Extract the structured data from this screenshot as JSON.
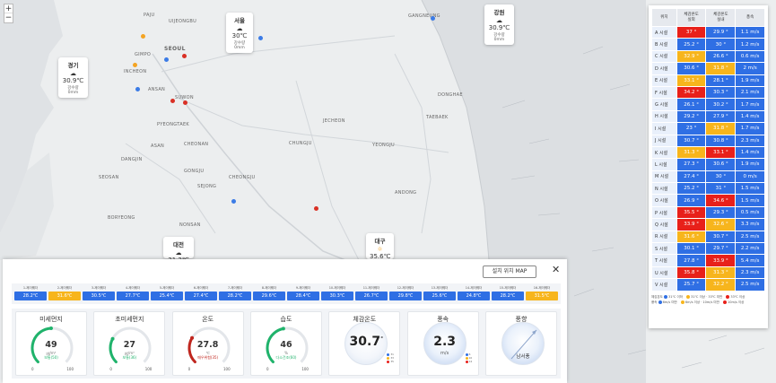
{
  "map": {
    "zoom_in": "+",
    "zoom_out": "−",
    "labels": [
      "PAJU",
      "UIJEONGBU",
      "GIMPO",
      "SEOUL",
      "INCHEON",
      "ANSAN",
      "SUWON",
      "PYEONGTAEK",
      "ASAN",
      "CHEONAN",
      "CHUNGJU",
      "JECHEON",
      "YEONGJU",
      "ANDONG",
      "CHEONGJU",
      "SEJONG",
      "GONGJU",
      "DANGJIN",
      "SEOSAN",
      "TAEBAEK",
      "DONGHAE",
      "GANGNEUNG",
      "NONSAN",
      "BORYEONG"
    ],
    "regions": [
      {
        "name": "서울",
        "temp": "30℃",
        "rain": "강수량 0mm"
      },
      {
        "name": "강원",
        "temp": "30.9℃",
        "rain": "강수량 0mm"
      },
      {
        "name": "경기",
        "temp": "30.9℃",
        "rain": "강수량 0mm"
      },
      {
        "name": "대전",
        "temp": "31.3℃",
        "rain": ""
      },
      {
        "name": "대구",
        "temp": "35.6℃",
        "rain": "강수량 0mm"
      }
    ]
  },
  "table": {
    "headers": [
      "위치",
      "체감온도\n실외",
      "체감온도\n실내",
      "풍속"
    ],
    "colors": {
      "red": "#e8201a",
      "yellow": "#f7b51c",
      "blue": "#2f6fe4"
    },
    "rows": [
      {
        "loc": "A 시설",
        "out": "37 °",
        "oc": "red",
        "in": "29.9 °",
        "ic": "blue",
        "wind": "1.1 m/s"
      },
      {
        "loc": "B 시설",
        "out": "25.2 °",
        "oc": "blue",
        "in": "30 °",
        "ic": "blue",
        "wind": "1.2 m/s"
      },
      {
        "loc": "C 시설",
        "out": "32.9 °",
        "oc": "yellow",
        "in": "26.6 °",
        "ic": "blue",
        "wind": "0.6 m/s"
      },
      {
        "loc": "D 시설",
        "out": "30.6 °",
        "oc": "blue",
        "in": "31.8 °",
        "ic": "yellow",
        "wind": "2 m/s"
      },
      {
        "loc": "E 시설",
        "out": "33.1 °",
        "oc": "yellow",
        "in": "28.1 °",
        "ic": "blue",
        "wind": "1.9 m/s"
      },
      {
        "loc": "F 시설",
        "out": "34.2 °",
        "oc": "red",
        "in": "30.3 °",
        "ic": "blue",
        "wind": "2.1 m/s"
      },
      {
        "loc": "G 시설",
        "out": "26.1 °",
        "oc": "blue",
        "in": "30.2 °",
        "ic": "blue",
        "wind": "1.7 m/s"
      },
      {
        "loc": "H 시설",
        "out": "29.2 °",
        "oc": "blue",
        "in": "27.9 °",
        "ic": "blue",
        "wind": "1.4 m/s"
      },
      {
        "loc": "I 시설",
        "out": "23 °",
        "oc": "blue",
        "in": "31.8 °",
        "ic": "yellow",
        "wind": "1.7 m/s"
      },
      {
        "loc": "J 시설",
        "out": "30.7 °",
        "oc": "blue",
        "in": "30.8 °",
        "ic": "blue",
        "wind": "2.3 m/s"
      },
      {
        "loc": "K 시설",
        "out": "31.3 °",
        "oc": "yellow",
        "in": "33.1 °",
        "ic": "red",
        "wind": "1.4 m/s"
      },
      {
        "loc": "L 시설",
        "out": "27.3 °",
        "oc": "blue",
        "in": "30.6 °",
        "ic": "blue",
        "wind": "1.9 m/s"
      },
      {
        "loc": "M 시설",
        "out": "27.4 °",
        "oc": "blue",
        "in": "30 °",
        "ic": "blue",
        "wind": "0 m/s"
      },
      {
        "loc": "N 시설",
        "out": "25.2 °",
        "oc": "blue",
        "in": "31 °",
        "ic": "blue",
        "wind": "1.5 m/s"
      },
      {
        "loc": "O 시설",
        "out": "26.9 °",
        "oc": "blue",
        "in": "34.6 °",
        "ic": "red",
        "wind": "1.5 m/s"
      },
      {
        "loc": "P 시설",
        "out": "35.5 °",
        "oc": "red",
        "in": "29.3 °",
        "ic": "blue",
        "wind": "0.5 m/s"
      },
      {
        "loc": "Q 시설",
        "out": "33.9 °",
        "oc": "red",
        "in": "32.6 °",
        "ic": "yellow",
        "wind": "3.3 m/s"
      },
      {
        "loc": "R 시설",
        "out": "31.6 °",
        "oc": "yellow",
        "in": "30.7 °",
        "ic": "blue",
        "wind": "2.5 m/s"
      },
      {
        "loc": "S 시설",
        "out": "30.1 °",
        "oc": "blue",
        "in": "29.7 °",
        "ic": "blue",
        "wind": "2.2 m/s"
      },
      {
        "loc": "T 시설",
        "out": "27.8 °",
        "oc": "blue",
        "in": "33.9 °",
        "ic": "red",
        "wind": "5.4 m/s"
      },
      {
        "loc": "U 시설",
        "out": "35.8 °",
        "oc": "red",
        "in": "31.3 °",
        "ic": "yellow",
        "wind": "2.3 m/s"
      },
      {
        "loc": "V 시설",
        "out": "25.7 °",
        "oc": "blue",
        "in": "32.2 °",
        "ic": "yellow",
        "wind": "2.5 m/s"
      }
    ],
    "legend_temp_title": "체감온도",
    "legend_temp": [
      "31℃ 이하",
      "31℃ 이상 · 33℃ 미만",
      "33℃ 이상"
    ],
    "legend_wind_title": "풍속",
    "legend_wind": [
      "6m/s 미만",
      "6m/s 이상 · 10m/s 미만",
      "10m/s 이상"
    ]
  },
  "bottom": {
    "install_map": "설치 위치 MAP",
    "close": "✕",
    "sensors": [
      {
        "name": "1-제이웨더",
        "value": "28.2℃",
        "color": "blue"
      },
      {
        "name": "2-제이웨더",
        "value": "31.6℃",
        "color": "yellow"
      },
      {
        "name": "3-제이웨더",
        "value": "30.5℃",
        "color": "blue"
      },
      {
        "name": "4-제이웨더",
        "value": "27.7℃",
        "color": "blue"
      },
      {
        "name": "5-제이웨더",
        "value": "25.4℃",
        "color": "blue"
      },
      {
        "name": "6-제이웨더",
        "value": "27.4℃",
        "color": "blue"
      },
      {
        "name": "7-제이웨더",
        "value": "28.2℃",
        "color": "blue"
      },
      {
        "name": "8-제이웨더",
        "value": "29.6℃",
        "color": "blue"
      },
      {
        "name": "9-제이웨더",
        "value": "28.4℃",
        "color": "blue"
      },
      {
        "name": "10-제이웨더",
        "value": "30.3℃",
        "color": "blue"
      },
      {
        "name": "11-제이웨더",
        "value": "26.7℃",
        "color": "blue"
      },
      {
        "name": "12-제이웨더",
        "value": "29.8℃",
        "color": "blue"
      },
      {
        "name": "13-제이웨더",
        "value": "25.6℃",
        "color": "blue"
      },
      {
        "name": "14-제이웨더",
        "value": "24.8℃",
        "color": "blue"
      },
      {
        "name": "15-제이웨더",
        "value": "28.2℃",
        "color": "blue"
      },
      {
        "name": "16-제이웨더",
        "value": "31.5℃",
        "color": "yellow"
      }
    ],
    "gauges": [
      {
        "title": "미세먼지",
        "value": "49",
        "unit": "㎍/m³",
        "status": "보통(50)",
        "min": "0",
        "max": "100",
        "fraction": 0.49,
        "color": "#1fb36b",
        "status_color": "#1fb36b"
      },
      {
        "title": "초미세먼지",
        "value": "27",
        "unit": "㎍/m³",
        "status": "보통(36)",
        "min": "0",
        "max": "100",
        "fraction": 0.27,
        "color": "#1fb36b",
        "status_color": "#1fb36b"
      },
      {
        "title": "온도",
        "value": "27.8",
        "unit": "℃",
        "status": "매우위험(35)",
        "min": "0",
        "max": "100",
        "fraction": 0.28,
        "color": "#c0261e",
        "status_color": "#c0261e"
      },
      {
        "title": "습도",
        "value": "46",
        "unit": "%",
        "status": "다소건조(60)",
        "min": "0",
        "max": "100",
        "fraction": 0.46,
        "color": "#1fb36b",
        "status_color": "#1fb36b"
      }
    ],
    "feels": {
      "title": "체감온도",
      "value": "30.7",
      "unit": "°",
      "legend": [
        "31",
        "33",
        "35"
      ]
    },
    "wind": {
      "title": "풍속",
      "value": "2.3",
      "unit": "m/s",
      "legend": [
        "6",
        "10",
        "14"
      ]
    },
    "direction": {
      "title": "풍향",
      "value": "남서풍"
    }
  }
}
